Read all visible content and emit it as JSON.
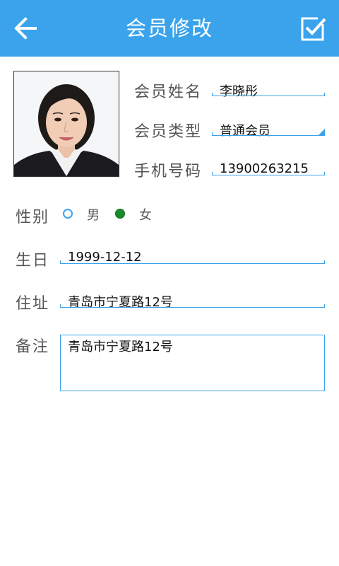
{
  "header": {
    "title": "会员修改",
    "background_color": "#3aa3ec",
    "back_icon": "arrow-left-icon",
    "confirm_icon": "checkbox-check-icon"
  },
  "member": {
    "photo_icon": "member-photo",
    "name_label": "会员姓名",
    "name_value": "李晓彤",
    "type_label": "会员类型",
    "type_value": "普通会员",
    "phone_label": "手机号码",
    "phone_value": "13900263215"
  },
  "gender": {
    "label": "性别",
    "options": [
      {
        "label": "男",
        "selected": false
      },
      {
        "label": "女",
        "selected": true
      }
    ]
  },
  "birthday": {
    "label": "生日",
    "value": "1999-12-12"
  },
  "address": {
    "label": "住址",
    "value": "青岛市宁夏路12号"
  },
  "notes": {
    "label": "备注",
    "value": "青岛市宁夏路12号"
  },
  "colors": {
    "accent": "#3aa3ec",
    "selected_radio": "#1a8a2c"
  }
}
